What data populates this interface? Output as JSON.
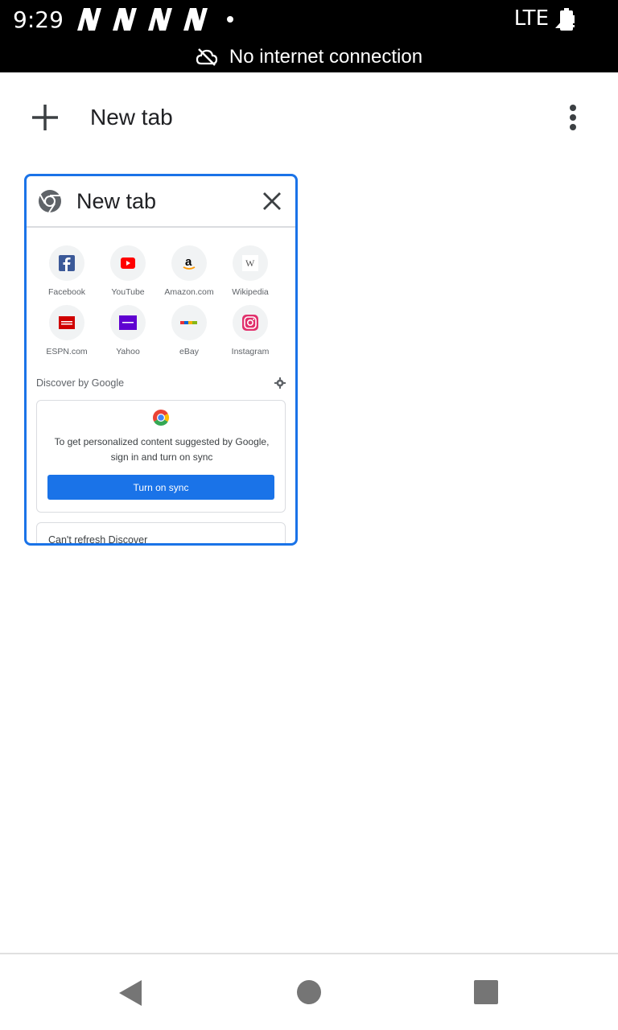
{
  "status_bar": {
    "time": "9:29",
    "network": "LTE",
    "notification_icons": [
      "n-icon",
      "n-icon",
      "n-icon",
      "n-icon"
    ],
    "offline_message": "No internet connection"
  },
  "toolbar": {
    "new_tab_label": "New tab"
  },
  "tab_card": {
    "title": "New tab",
    "shortcuts": [
      {
        "label": "Facebook",
        "icon": "facebook-icon",
        "color": "#3b5998"
      },
      {
        "label": "YouTube",
        "icon": "youtube-icon",
        "color": "#ff0000"
      },
      {
        "label": "Amazon.com",
        "icon": "amazon-icon",
        "color": "#000000"
      },
      {
        "label": "Wikipedia",
        "icon": "wikipedia-icon",
        "color": "#555555"
      },
      {
        "label": "ESPN.com",
        "icon": "espn-icon",
        "color": "#d00000"
      },
      {
        "label": "Yahoo",
        "icon": "yahoo-icon",
        "color": "#5f01d1"
      },
      {
        "label": "eBay",
        "icon": "ebay-icon",
        "color": "#e53238"
      },
      {
        "label": "Instagram",
        "icon": "instagram-icon",
        "color": "#c13584"
      }
    ],
    "discover_label": "Discover by Google",
    "sync_message": "To get personalized content suggested by Google, sign in and turn on sync",
    "sync_button": "Turn on sync",
    "refresh_message": "Can't refresh Discover"
  },
  "colors": {
    "accent": "#1a73e8",
    "status_bar_bg": "#000000"
  }
}
